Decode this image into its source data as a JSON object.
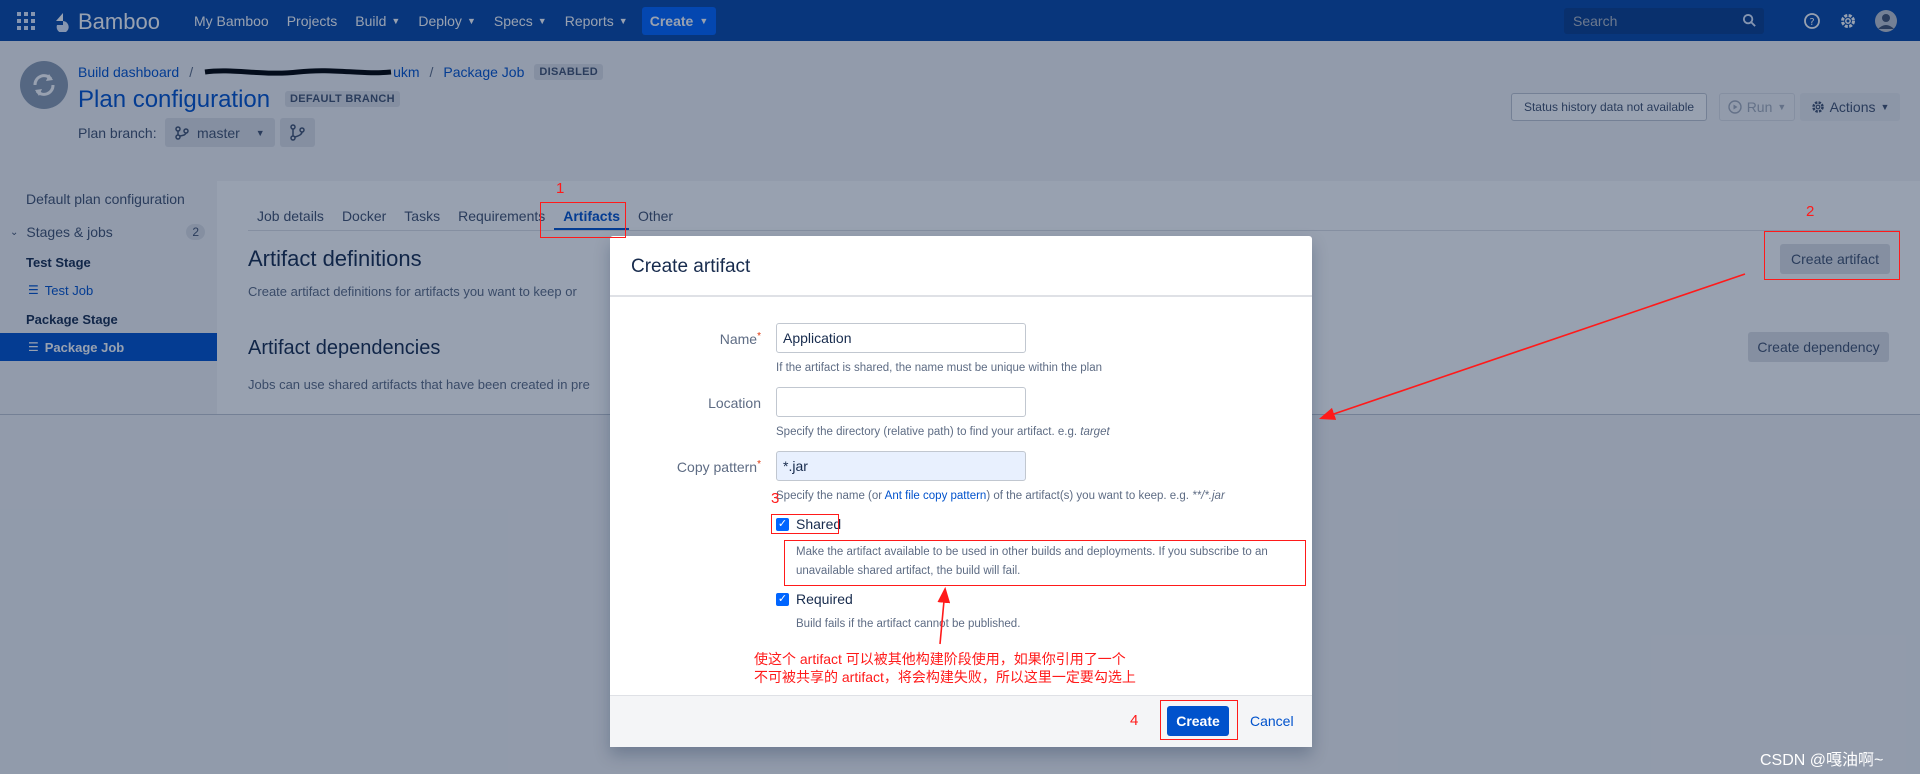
{
  "topnav": {
    "brand": "Bamboo",
    "items": [
      {
        "label": "My Bamboo",
        "has_menu": false
      },
      {
        "label": "Projects",
        "has_menu": false
      },
      {
        "label": "Build",
        "has_menu": true
      },
      {
        "label": "Deploy",
        "has_menu": true
      },
      {
        "label": "Specs",
        "has_menu": true
      },
      {
        "label": "Reports",
        "has_menu": true
      }
    ],
    "create_label": "Create",
    "search_placeholder": "Search"
  },
  "header": {
    "breadcrumb": [
      "Build dashboard",
      "ukm",
      "Package Job"
    ],
    "disabled_badge": "DISABLED",
    "title": "Plan configuration",
    "default_branch_badge": "DEFAULT BRANCH",
    "plan_branch_label": "Plan branch:",
    "branch_value": "master",
    "status_text": "Status history data not available",
    "run_label": "Run",
    "actions_label": "Actions"
  },
  "sidebar": {
    "default_plan": "Default plan configuration",
    "stages_label": "Stages & jobs",
    "stages_count": "2",
    "stages": [
      {
        "name": "Test Stage",
        "job": "Test Job"
      },
      {
        "name": "Package Stage",
        "job": "Package Job"
      }
    ]
  },
  "main": {
    "tabs": [
      "Job details",
      "Docker",
      "Tasks",
      "Requirements",
      "Artifacts",
      "Other"
    ],
    "active_tab": "Artifacts",
    "artifact_definitions_title": "Artifact definitions",
    "artifact_definitions_desc": "Create artifact definitions for artifacts you want to keep or",
    "create_artifact_label": "Create artifact",
    "artifact_dependencies_title": "Artifact dependencies",
    "artifact_dependencies_desc": "Jobs can use shared artifacts that have been created in pre",
    "create_dependency_label": "Create dependency"
  },
  "modal": {
    "title": "Create artifact",
    "name_label": "Name",
    "name_value": "Application",
    "name_help": "If the artifact is shared, the name must be unique within the plan",
    "location_label": "Location",
    "location_value": "",
    "location_help_pre": "Specify the directory (relative path) to find your artifact. e.g.",
    "location_help_example": "target",
    "pattern_label": "Copy pattern",
    "pattern_value": "*.jar",
    "pattern_help_pre": "Specify the name (or",
    "pattern_help_link": "Ant file copy pattern",
    "pattern_help_post": ") of the artifact(s) you want to keep. e.g.",
    "pattern_help_example": "**/*.jar",
    "shared_label": "Shared",
    "shared_checked": true,
    "shared_help_1": "Make the artifact available to be used in other builds and deployments. If you subscribe to an",
    "shared_help_2": "unavailable shared artifact, the build will fail.",
    "required_label": "Required",
    "required_checked": true,
    "required_help": "Build fails if the artifact cannot be published.",
    "submit_label": "Create",
    "cancel_label": "Cancel"
  },
  "annotations": {
    "numbers": [
      "1",
      "2",
      "3",
      "4"
    ],
    "note_line1": "使这个 artifact 可以被其他构建阶段使用，如果你引用了一个",
    "note_line2": "不可被共享的 artifact，将会构建失败，所以这里一定要勾选上",
    "color": "#ff1a1a"
  },
  "watermark": "CSDN @嘎油啊~",
  "colors": {
    "nav_bg": "#0747a6",
    "primary": "#0052cc",
    "create_bg": "#0065ff"
  }
}
